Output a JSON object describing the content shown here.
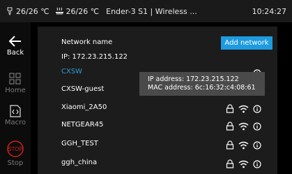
{
  "status_bar": {
    "nozzle_temp": "26/26 ℃",
    "bed_temp": "26/26 ℃",
    "title": "Ender-3 S1 | Wireless ...",
    "time": "10:24:27"
  },
  "sidebar": {
    "back_label": "Back",
    "home_label": "Home",
    "macro_label": "Macro",
    "stop_label": "Stop",
    "stop_icon_text": "STOP"
  },
  "network": {
    "header_label": "Network name",
    "ip_label": "IP: 172.23.215.122",
    "add_button": "Add network",
    "networks": [
      {
        "name": "CXSW",
        "connected": true
      },
      {
        "name": "CXSW-guest",
        "connected": false
      },
      {
        "name": "Xiaomi_2A50",
        "connected": false
      },
      {
        "name": "NETGEAR45",
        "connected": false
      },
      {
        "name": "GGH_TEST",
        "connected": false
      },
      {
        "name": "ggh_china",
        "connected": false
      }
    ],
    "tooltip": {
      "ip": "IP address: 172.23.215.122",
      "mac": "MAC address: 6c:16:32:c4:08:61"
    }
  },
  "colors": {
    "accent": "#1e9be0",
    "active_network": "#2e9bd6",
    "stop_red": "#d0201a"
  }
}
